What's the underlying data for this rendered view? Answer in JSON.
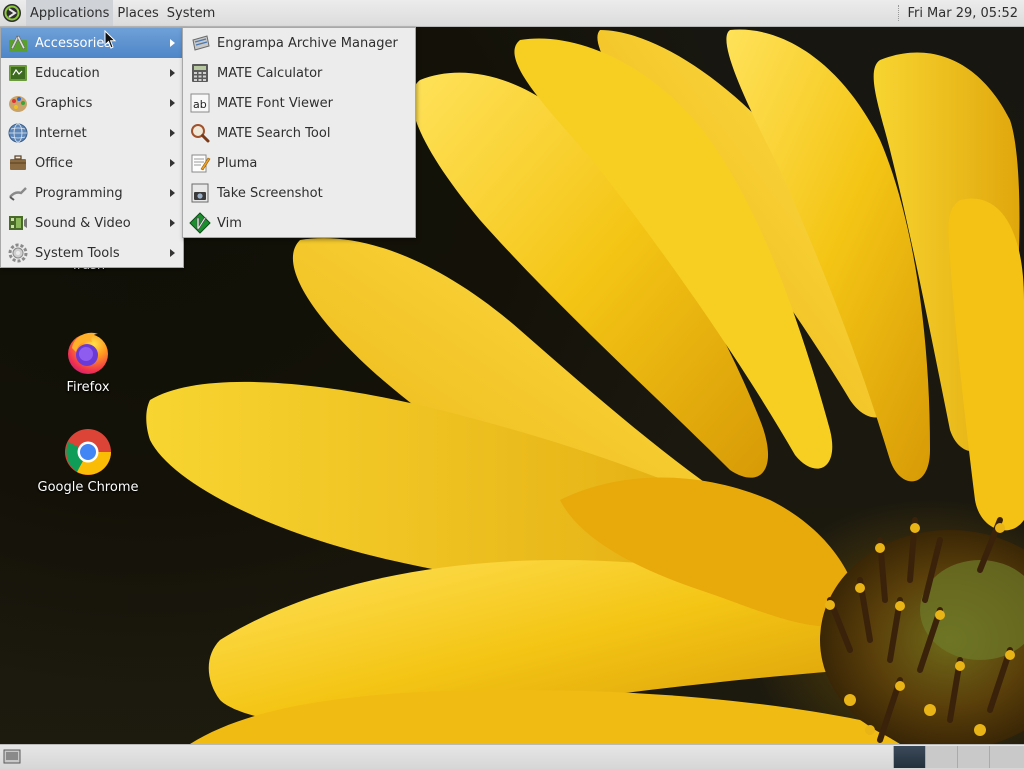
{
  "top_panel": {
    "menus": [
      "Applications",
      "Places",
      "System"
    ],
    "clock": "Fri Mar 29, 05:52"
  },
  "applications_menu": {
    "items": [
      {
        "label": "Accessories",
        "icon": "accessories-icon",
        "selected": true
      },
      {
        "label": "Education",
        "icon": "education-icon"
      },
      {
        "label": "Graphics",
        "icon": "graphics-icon"
      },
      {
        "label": "Internet",
        "icon": "internet-globe-icon"
      },
      {
        "label": "Office",
        "icon": "office-icon"
      },
      {
        "label": "Programming",
        "icon": "programming-icon"
      },
      {
        "label": "Sound & Video",
        "icon": "sound-video-icon"
      },
      {
        "label": "System Tools",
        "icon": "system-tools-gear-icon"
      }
    ]
  },
  "accessories_menu": {
    "items": [
      {
        "label": "Engrampa Archive Manager",
        "icon": "archive-manager-icon"
      },
      {
        "label": "MATE Calculator",
        "icon": "calculator-icon"
      },
      {
        "label": "MATE Font Viewer",
        "icon": "font-viewer-icon"
      },
      {
        "label": "MATE Search Tool",
        "icon": "search-magnifier-icon"
      },
      {
        "label": "Pluma",
        "icon": "text-editor-icon"
      },
      {
        "label": "Take Screenshot",
        "icon": "screenshot-camera-icon"
      },
      {
        "label": "Vim",
        "icon": "vim-icon"
      }
    ]
  },
  "desktop": {
    "icons": [
      {
        "label": "Trash",
        "icon": "trash-icon"
      },
      {
        "label": "Firefox",
        "icon": "firefox-icon"
      },
      {
        "label": "Google Chrome",
        "icon": "chrome-icon"
      }
    ]
  },
  "colors": {
    "menu_highlight": "#5b8fcf",
    "panel_bg": "#e4e4e4",
    "wallpaper_petal": "#f2c418"
  }
}
